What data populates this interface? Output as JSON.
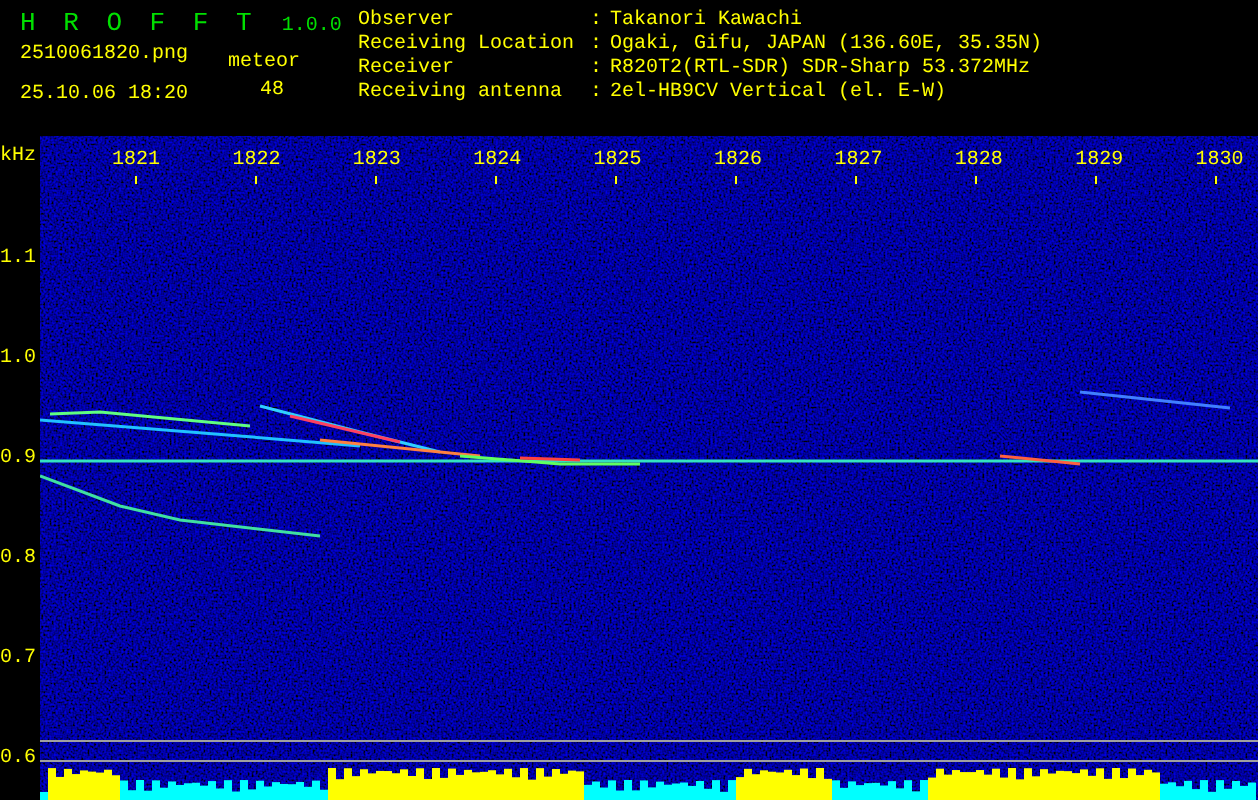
{
  "app": {
    "title": "H R O F F T",
    "version": "1.0.0"
  },
  "file_name": "2510061820.png",
  "datetime": "25.10.06 18:20",
  "meteor": {
    "label": "meteor",
    "count": "48"
  },
  "info": [
    {
      "label": "Observer",
      "value": "Takanori Kawachi"
    },
    {
      "label": "Receiving Location",
      "value": "Ogaki, Gifu, JAPAN (136.60E, 35.35N)"
    },
    {
      "label": "Receiver",
      "value": "R820T2(RTL-SDR) SDR-Sharp 53.372MHz"
    },
    {
      "label": "Receiving antenna",
      "value": "2el-HB9CV Vertical (el. E-W)"
    }
  ],
  "info_separator": ":",
  "y_unit": "kHz",
  "x_ticks": [
    "1821",
    "1822",
    "1823",
    "1824",
    "1825",
    "1826",
    "1827",
    "1828",
    "1829",
    "1830"
  ],
  "y_ticks": [
    "1.1",
    "1.0",
    "0.9",
    "0.8",
    "0.7",
    "0.6"
  ]
}
